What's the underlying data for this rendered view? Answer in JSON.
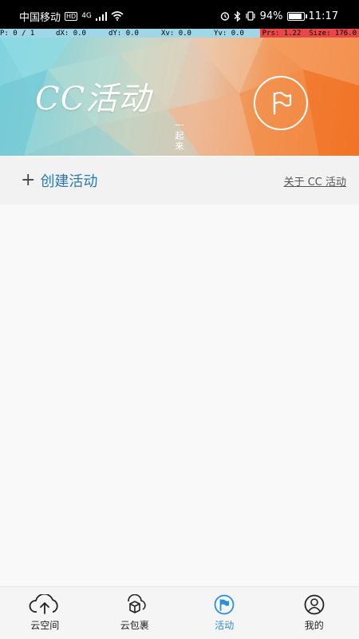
{
  "status_bar": {
    "carrier": "中国移动",
    "hd": "HD",
    "network": "4G",
    "battery_percent": "94%",
    "battery_level": 0.94,
    "time": "11:17"
  },
  "debug": {
    "p": "P: 0 / 1",
    "dx": "dX: 0.0",
    "dy": "dY: 0.0",
    "xv": "Xv: 0.0",
    "yv": "Yv: 0.0",
    "prs": "Prs: 1.22",
    "size": "Size: 176.0"
  },
  "banner": {
    "title": "CC活动",
    "subtitle": "一起来"
  },
  "actions": {
    "create_label": "创建活动",
    "about_label": "关于 CC 活动"
  },
  "tabs": [
    {
      "label": "云空间",
      "icon": "cloud-upload-icon"
    },
    {
      "label": "云包裹",
      "icon": "package-icon"
    },
    {
      "label": "活动",
      "icon": "flag-icon",
      "active": true
    },
    {
      "label": "我的",
      "icon": "user-icon"
    }
  ],
  "colors": {
    "accent": "#2b8fd6",
    "banner_orange": "#f27a2e",
    "banner_cyan": "#7fd3e0"
  }
}
